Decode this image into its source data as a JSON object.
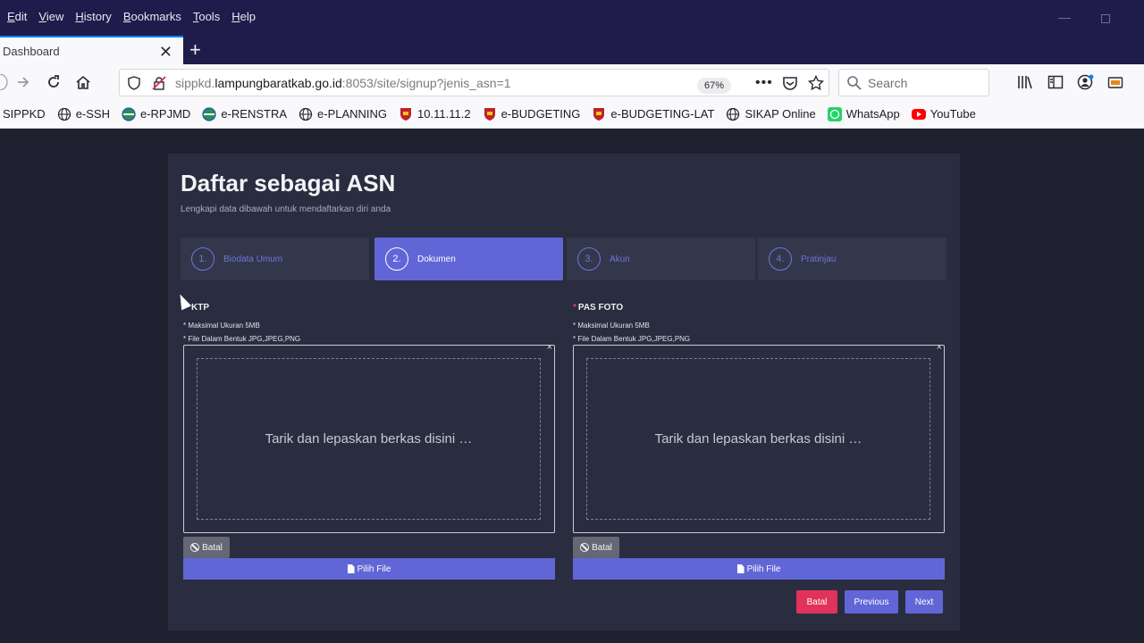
{
  "menu": {
    "items": [
      {
        "label": "Edit",
        "u": "E",
        "rest": "dit"
      },
      {
        "label": "View",
        "u": "V",
        "rest": "iew"
      },
      {
        "label": "History",
        "u": "H",
        "rest": "istory"
      },
      {
        "label": "Bookmarks",
        "u": "B",
        "rest": "ookmarks"
      },
      {
        "label": "Tools",
        "u": "T",
        "rest": "ools"
      },
      {
        "label": "Help",
        "u": "H",
        "rest": "elp"
      }
    ]
  },
  "tab": {
    "title": "Dashboard",
    "close": "✕",
    "new": "+"
  },
  "nav": {
    "url_host": "sippkd.",
    "url_domain": "lampungbaratkab.go.id",
    "url_path": ":8053/site/signup?jenis_asn=1",
    "zoom": "67%",
    "search_placeholder": "Search"
  },
  "bookmarks": [
    {
      "label": "SIPPKD",
      "icon": "none"
    },
    {
      "label": "e-SSH",
      "icon": "globe-icon"
    },
    {
      "label": "e-RPJMD",
      "icon": "site-icon"
    },
    {
      "label": "e-RENSTRA",
      "icon": "site-icon"
    },
    {
      "label": "e-PLANNING",
      "icon": "globe-icon"
    },
    {
      "label": "10.11.11.2",
      "icon": "shield-icon"
    },
    {
      "label": "e-BUDGETING",
      "icon": "shield-icon"
    },
    {
      "label": "e-BUDGETING-LAT",
      "icon": "shield-icon"
    },
    {
      "label": "SIKAP Online",
      "icon": "globe-icon"
    },
    {
      "label": "WhatsApp",
      "icon": "whatsapp-icon"
    },
    {
      "label": "YouTube",
      "icon": "youtube-icon"
    }
  ],
  "page": {
    "title": "Daftar sebagai ASN",
    "subtitle": "Lengkapi data dibawah untuk mendaftarkan diri anda",
    "steps": [
      {
        "num": "1.",
        "label": "Biodata Umum",
        "active": false
      },
      {
        "num": "2.",
        "label": "Dokumen",
        "active": true
      },
      {
        "num": "3.",
        "label": "Akun",
        "active": false
      },
      {
        "num": "4.",
        "label": "Pratinjau",
        "active": false
      }
    ],
    "uploads": [
      {
        "label": "KTP",
        "required_mark": "",
        "note1": "* Maksimal Ukuran 5MB",
        "note2": "* File Dalam Bentuk JPG,JPEG,PNG",
        "drop_text": "Tarik dan lepaskan berkas disini …",
        "remove": "×",
        "cancel_label": "Batal",
        "choose_label": "Pilih File"
      },
      {
        "label": "PAS FOTO",
        "required_mark": "*",
        "note1": "* Maksimal Ukuran 5MB",
        "note2": "* File Dalam Bentuk JPG,JPEG,PNG",
        "drop_text": "Tarik dan lepaskan berkas disini …",
        "remove": "×",
        "cancel_label": "Batal",
        "choose_label": "Pilih File"
      }
    ],
    "actions": {
      "cancel": "Batal",
      "previous": "Previous",
      "next": "Next"
    }
  },
  "colors": {
    "accent": "#6166d6",
    "danger": "#e0325a",
    "bg": "#1f2130",
    "card": "#2a2d3f"
  }
}
